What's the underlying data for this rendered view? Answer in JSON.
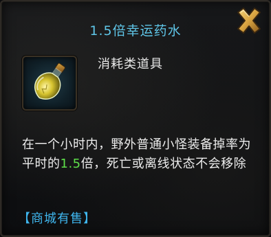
{
  "tooltip": {
    "title": "1.5倍幸运药水",
    "item_type": "消耗类道具",
    "description": {
      "before": "在一个小时内，野外普通小怪装备掉率为平时的",
      "highlight": "1.5",
      "after": "倍，死亡或离线状态不会移除"
    },
    "shop_tag": "【商城有售】",
    "icons": {
      "close": "close-x-icon",
      "item": "potion-bottle-icon"
    },
    "colors": {
      "title": "#5fc6e8",
      "highlight": "#5fe04a",
      "shop_tag": "#3fb6ee",
      "close": "#d9a441"
    }
  }
}
